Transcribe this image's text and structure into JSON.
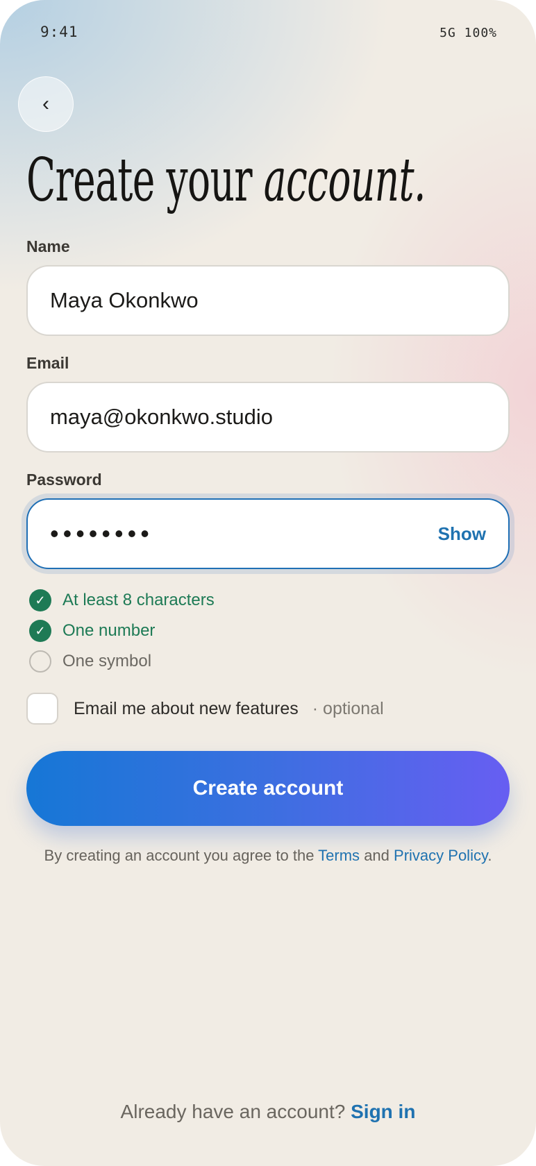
{
  "status_bar": {
    "time": "9:41",
    "network": "5G",
    "battery": "100%"
  },
  "back": {
    "icon": "chevron-left-icon",
    "glyph": "‹"
  },
  "headline": {
    "prefix": "Create your",
    "emphasis": "account."
  },
  "form": {
    "name": {
      "label": "Name",
      "value": "Maya Okonkwo"
    },
    "email": {
      "label": "Email",
      "value": "maya@okonkwo.studio"
    },
    "password": {
      "label": "Password",
      "masked_value": "••••••••",
      "toggle_label": "Show"
    }
  },
  "password_rules": [
    {
      "text": "At least 8 characters",
      "met": true
    },
    {
      "text": "One number",
      "met": true
    },
    {
      "text": "One symbol",
      "met": false
    }
  ],
  "rule_icons": {
    "met": "✓",
    "unmet": ""
  },
  "marketing_optin": {
    "label": "Email me about new features",
    "suffix": "· optional",
    "checked": false
  },
  "primary_button": {
    "label": "Create account"
  },
  "terms": {
    "prefix": "By creating an account you agree to the",
    "terms_link": "Terms",
    "conjunction": "and",
    "privacy_link": "Privacy Policy",
    "suffix": "."
  },
  "footer": {
    "prompt": "Already have an account?",
    "signin_link": "Sign in"
  },
  "colors": {
    "background": "#f1ece4",
    "accent": "#1f72b0",
    "success": "#1d7a55",
    "button_gradient_start": "#1677d6",
    "button_gradient_end": "#675ef2"
  }
}
